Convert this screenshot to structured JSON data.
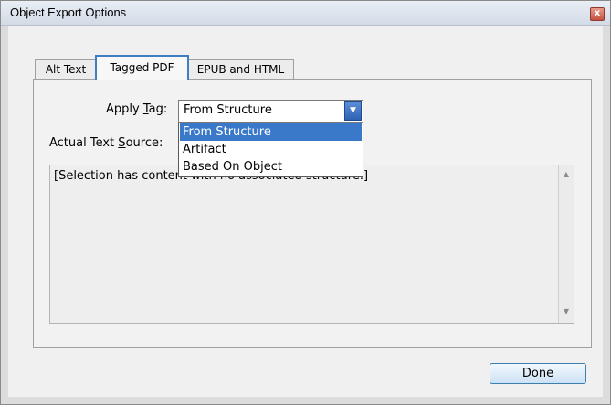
{
  "window": {
    "title": "Object Export Options",
    "close_symbol": "x"
  },
  "tabs": [
    {
      "label": "Alt Text",
      "active": false
    },
    {
      "label": "Tagged PDF",
      "active": true
    },
    {
      "label": "EPUB and HTML",
      "active": false
    }
  ],
  "apply_tag": {
    "label_before": "Apply ",
    "label_accel": "T",
    "label_after": "ag:",
    "value": "From Structure",
    "options": [
      "From Structure",
      "Artifact",
      "Based On Object"
    ],
    "highlighted_index": 0
  },
  "actual_text_source": {
    "label_before": "Actual Text ",
    "label_accel": "S",
    "label_after": "ource:",
    "content": "[Selection has content with no associated structure.]"
  },
  "buttons": {
    "done_label": "Done"
  },
  "icons": {
    "dropdown": "chevron-down-icon",
    "scroll_up": "scroll-up-icon",
    "scroll_down": "scroll-down-icon",
    "close": "close-icon"
  },
  "colors": {
    "active_tab_border": "#3d7fc2",
    "dropdown_highlight": "#3a78c9"
  }
}
